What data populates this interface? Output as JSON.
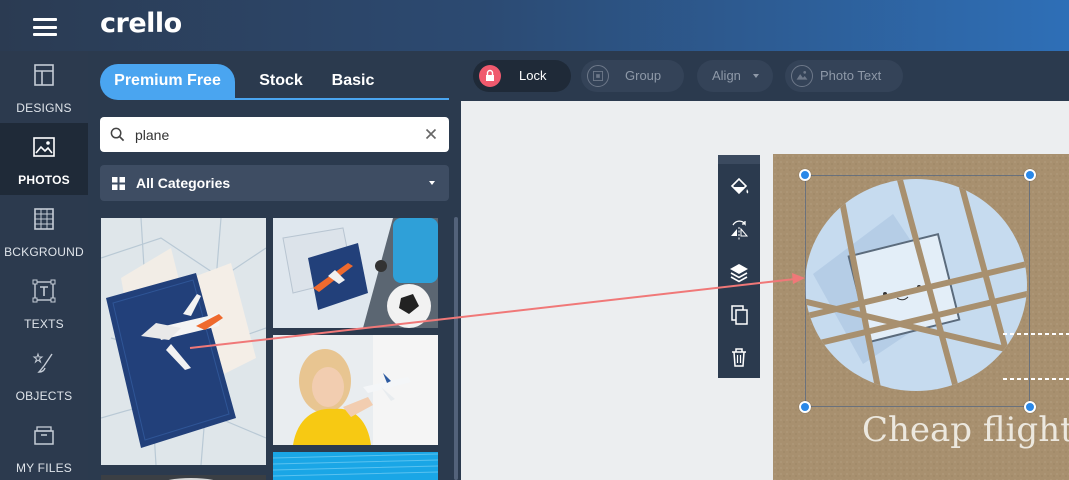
{
  "app": {
    "logo": "crello"
  },
  "leftnav": {
    "items": [
      {
        "label": "DESIGNS",
        "icon": "designs-icon"
      },
      {
        "label": "PHOTOS",
        "icon": "photos-icon",
        "active": true
      },
      {
        "label": "BCKGROUND",
        "icon": "background-icon"
      },
      {
        "label": "TEXTS",
        "icon": "texts-icon"
      },
      {
        "label": "OBJECTS",
        "icon": "objects-icon"
      },
      {
        "label": "MY FILES",
        "icon": "my-files-icon"
      }
    ]
  },
  "panel": {
    "tabs": [
      {
        "label": "Premium Free",
        "active": true
      },
      {
        "label": "Stock"
      },
      {
        "label": "Basic"
      }
    ],
    "search": {
      "value": "plane",
      "placeholder": ""
    },
    "categories": {
      "label": "All Categories"
    }
  },
  "toolbar": {
    "lock": "Lock",
    "group": "Group",
    "align": "Align",
    "photo_text": "Photo Text"
  },
  "canvas": {
    "headline": "Cheap flight"
  },
  "colors": {
    "accent": "#4aa5f0",
    "lock": "#f05a6e",
    "arrow": "#f07878"
  }
}
